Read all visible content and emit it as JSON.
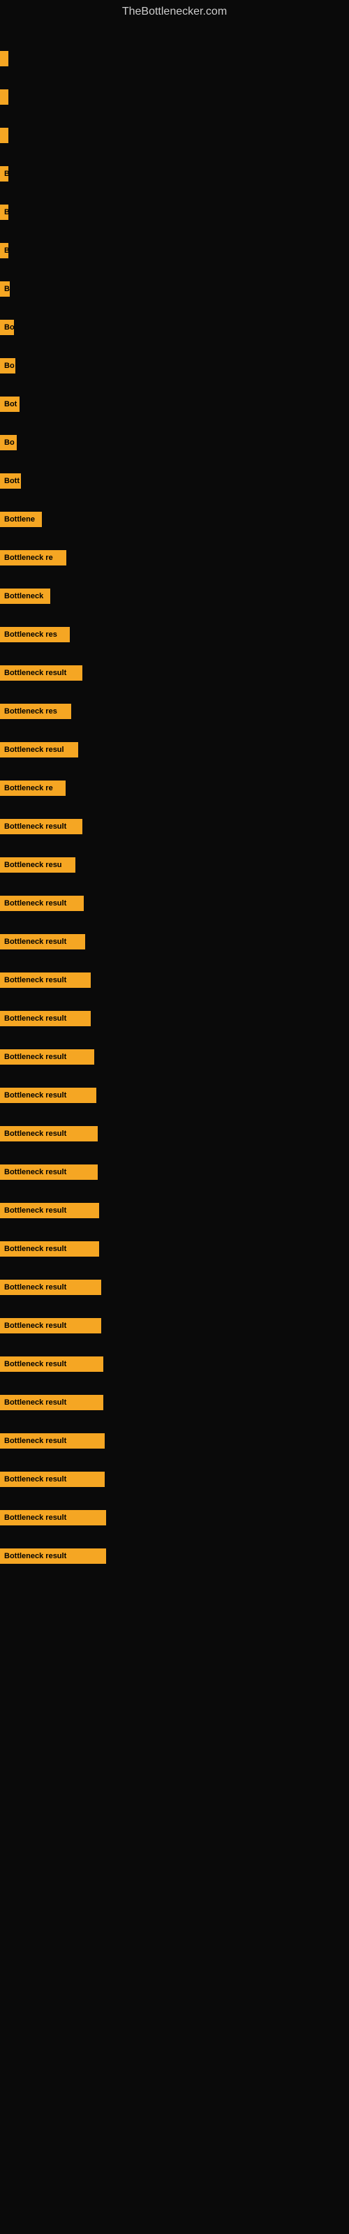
{
  "site": {
    "title": "TheBottlenecker.com"
  },
  "bars": [
    {
      "label": "",
      "width": 3,
      "marginTop": 30
    },
    {
      "label": "",
      "width": 5,
      "marginTop": 20
    },
    {
      "label": "",
      "width": 5,
      "marginTop": 20
    },
    {
      "label": "B",
      "width": 10,
      "marginTop": 20
    },
    {
      "label": "B",
      "width": 10,
      "marginTop": 20
    },
    {
      "label": "B",
      "width": 10,
      "marginTop": 20
    },
    {
      "label": "B",
      "width": 14,
      "marginTop": 20
    },
    {
      "label": "Bo",
      "width": 20,
      "marginTop": 20
    },
    {
      "label": "Bo",
      "width": 22,
      "marginTop": 20
    },
    {
      "label": "Bot",
      "width": 28,
      "marginTop": 20
    },
    {
      "label": "Bo",
      "width": 24,
      "marginTop": 20
    },
    {
      "label": "Bott",
      "width": 30,
      "marginTop": 20
    },
    {
      "label": "Bottlene",
      "width": 60,
      "marginTop": 20
    },
    {
      "label": "Bottleneck re",
      "width": 95,
      "marginTop": 20
    },
    {
      "label": "Bottleneck",
      "width": 72,
      "marginTop": 20
    },
    {
      "label": "Bottleneck res",
      "width": 100,
      "marginTop": 20
    },
    {
      "label": "Bottleneck result",
      "width": 118,
      "marginTop": 20
    },
    {
      "label": "Bottleneck res",
      "width": 102,
      "marginTop": 20
    },
    {
      "label": "Bottleneck resul",
      "width": 112,
      "marginTop": 20
    },
    {
      "label": "Bottleneck re",
      "width": 94,
      "marginTop": 20
    },
    {
      "label": "Bottleneck result",
      "width": 118,
      "marginTop": 20
    },
    {
      "label": "Bottleneck resu",
      "width": 108,
      "marginTop": 20
    },
    {
      "label": "Bottleneck result",
      "width": 120,
      "marginTop": 20
    },
    {
      "label": "Bottleneck result",
      "width": 122,
      "marginTop": 20
    },
    {
      "label": "Bottleneck result",
      "width": 130,
      "marginTop": 20
    },
    {
      "label": "Bottleneck result",
      "width": 130,
      "marginTop": 20
    },
    {
      "label": "Bottleneck result",
      "width": 135,
      "marginTop": 20
    },
    {
      "label": "Bottleneck result",
      "width": 138,
      "marginTop": 20
    },
    {
      "label": "Bottleneck result",
      "width": 140,
      "marginTop": 20
    },
    {
      "label": "Bottleneck result",
      "width": 140,
      "marginTop": 20
    },
    {
      "label": "Bottleneck result",
      "width": 142,
      "marginTop": 20
    },
    {
      "label": "Bottleneck result",
      "width": 142,
      "marginTop": 20
    },
    {
      "label": "Bottleneck result",
      "width": 145,
      "marginTop": 20
    },
    {
      "label": "Bottleneck result",
      "width": 145,
      "marginTop": 20
    },
    {
      "label": "Bottleneck result",
      "width": 148,
      "marginTop": 20
    },
    {
      "label": "Bottleneck result",
      "width": 148,
      "marginTop": 20
    },
    {
      "label": "Bottleneck result",
      "width": 150,
      "marginTop": 20
    },
    {
      "label": "Bottleneck result",
      "width": 150,
      "marginTop": 20
    },
    {
      "label": "Bottleneck result",
      "width": 152,
      "marginTop": 20
    },
    {
      "label": "Bottleneck result",
      "width": 152,
      "marginTop": 20
    }
  ]
}
